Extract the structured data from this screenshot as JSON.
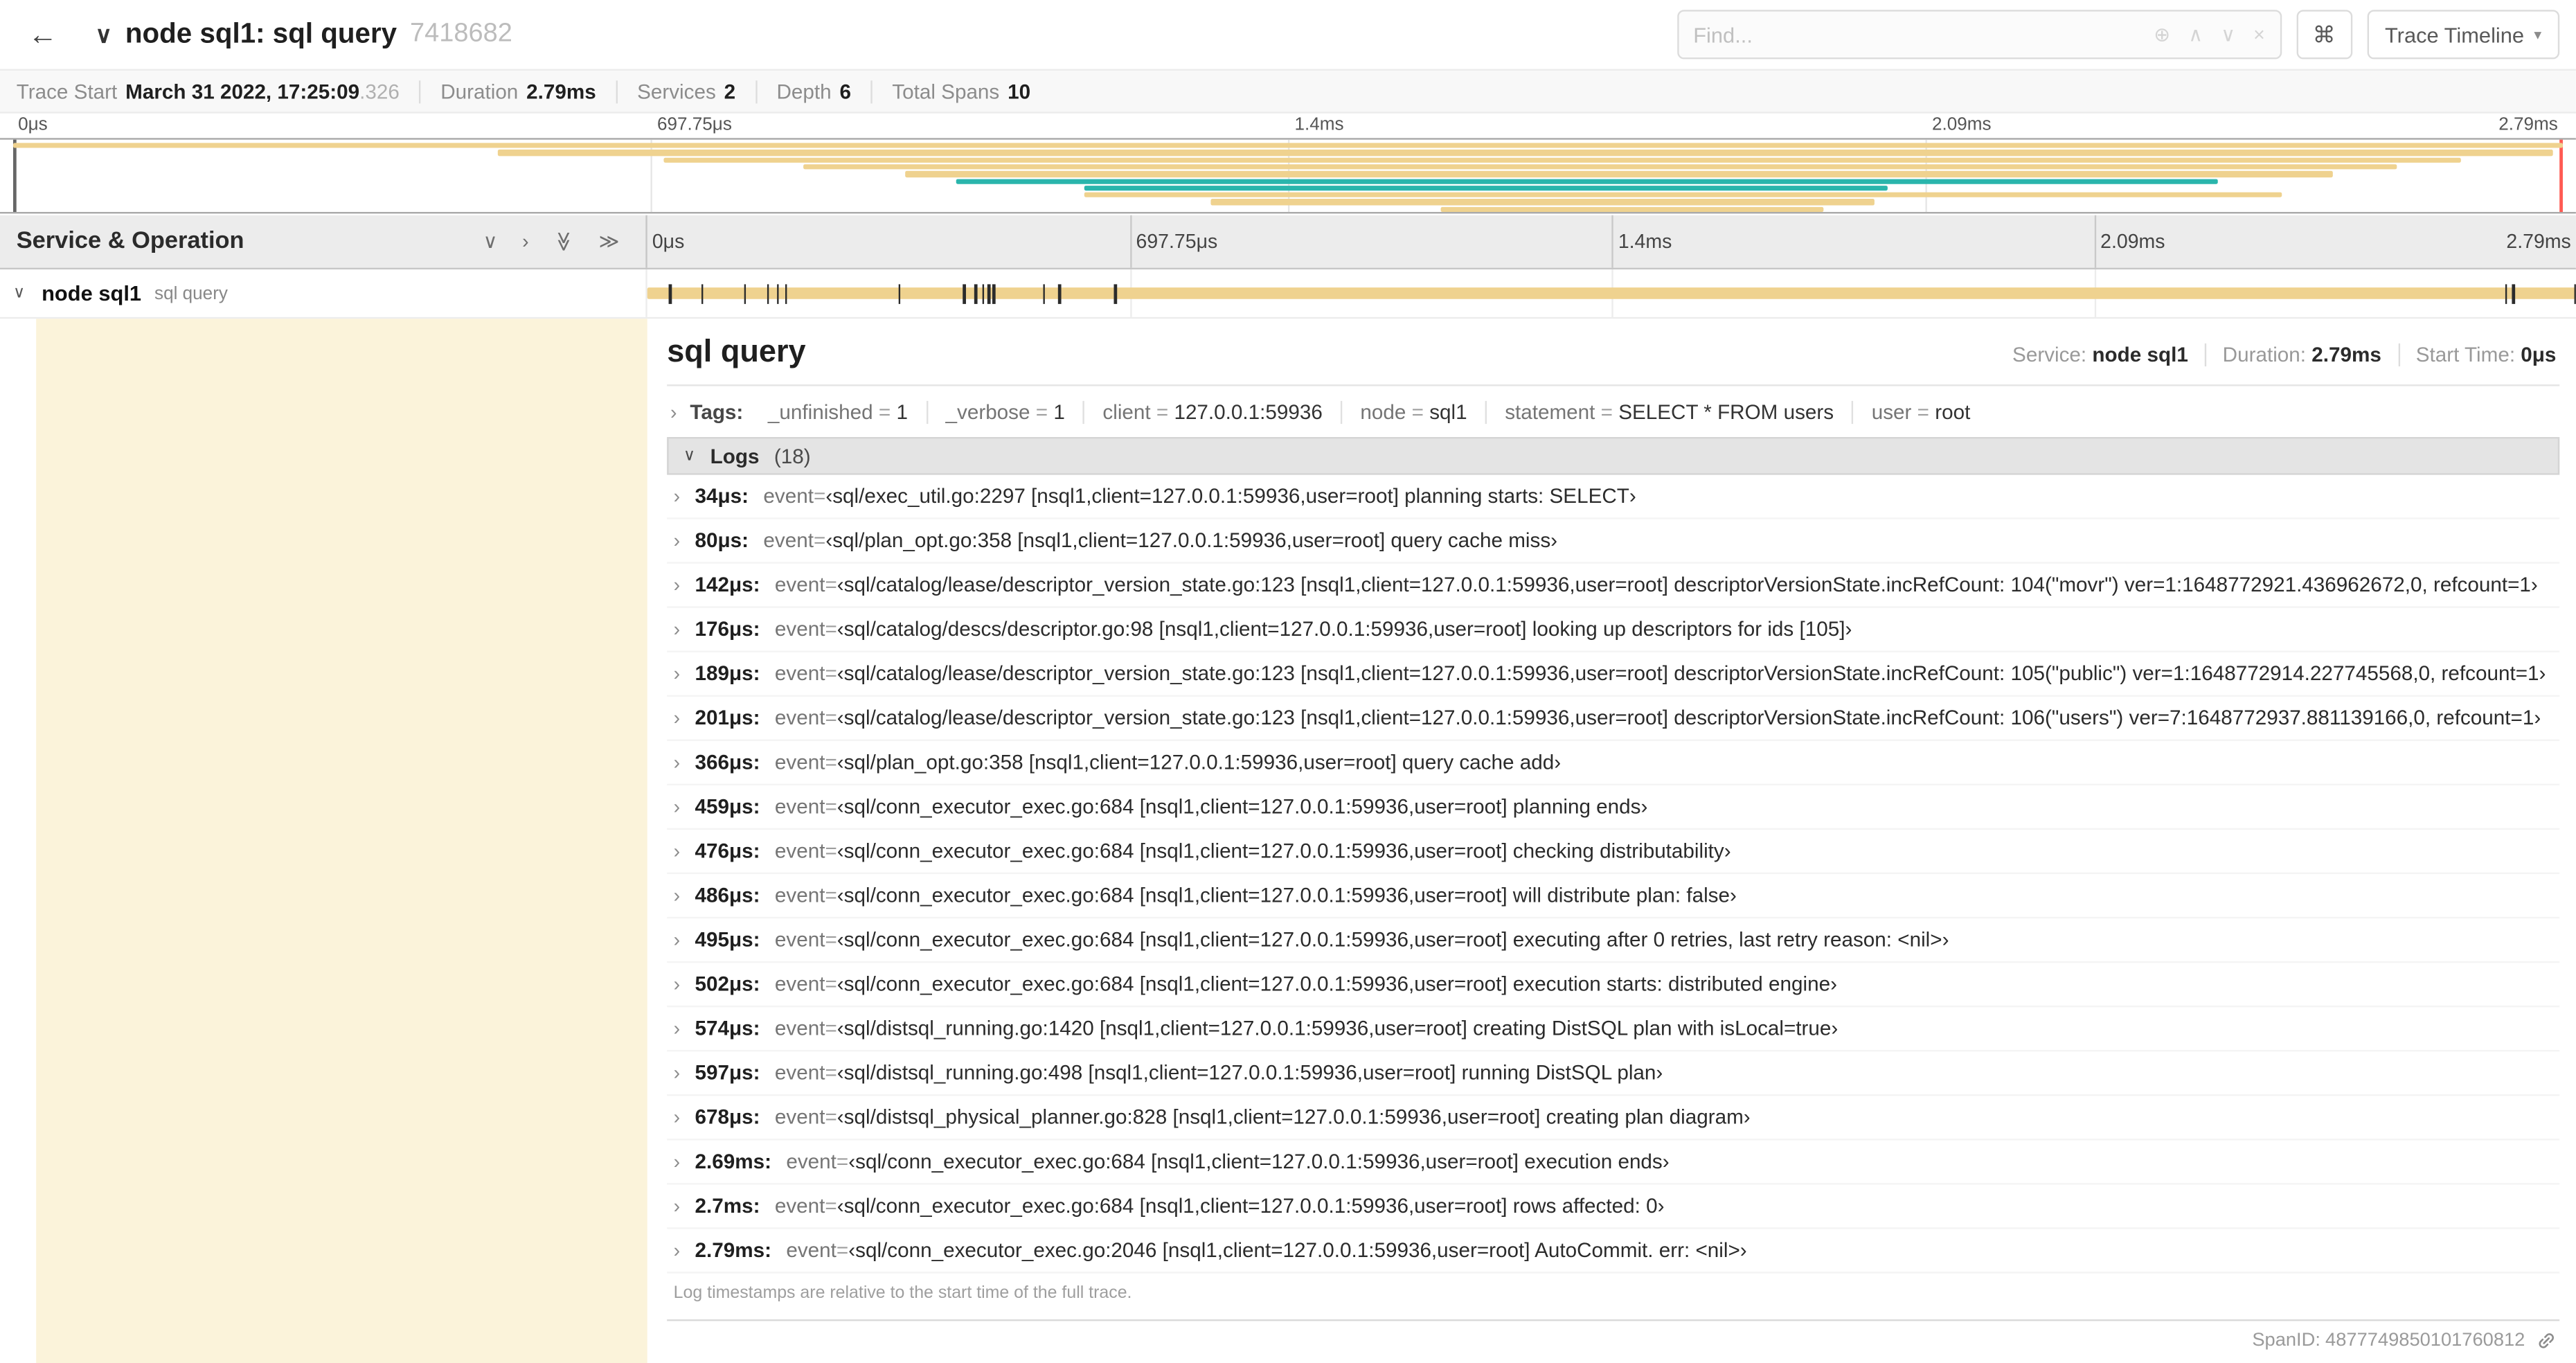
{
  "header": {
    "title": "node sql1: sql query",
    "trace_id": "7418682",
    "find_placeholder": "Find...",
    "trace_timeline_label": "Trace Timeline"
  },
  "icons": {
    "back": "←",
    "collapse_trace": "∨",
    "find_zoom": "⊕",
    "find_prev": "∧",
    "find_next": "∨",
    "find_clear": "×",
    "keyboard_shortcuts": "⌘",
    "dropdown_caret": "▾",
    "collapse_one": "∨",
    "expand_one": "›",
    "collapse_all": "≫",
    "expand_all": "≫",
    "row_chevron": "∨",
    "logs_chevron": "∨"
  },
  "stats": {
    "items": [
      {
        "label": "Trace Start",
        "value": "March 31 2022, 17:25:09",
        "muted": ".326"
      },
      {
        "label": "Duration",
        "value": "2.79ms"
      },
      {
        "label": "Services",
        "value": "2"
      },
      {
        "label": "Depth",
        "value": "6"
      },
      {
        "label": "Total Spans",
        "value": "10"
      }
    ]
  },
  "minimap": {
    "tick_labels": [
      "0μs",
      "697.75μs",
      "1.4ms",
      "2.09ms",
      "2.79ms"
    ],
    "colors": {
      "tan": "#efd28f",
      "teal": "#2ab5ac"
    },
    "spans": [
      {
        "start": 0,
        "end": 100,
        "color": "tan"
      },
      {
        "start": 19,
        "end": 99.6,
        "color": "tan"
      },
      {
        "start": 25.5,
        "end": 96,
        "color": "tan"
      },
      {
        "start": 31,
        "end": 93.5,
        "color": "tan"
      },
      {
        "start": 35,
        "end": 91,
        "color": "tan"
      },
      {
        "start": 37,
        "end": 86.5,
        "color": "teal"
      },
      {
        "start": 42,
        "end": 73.5,
        "color": "teal"
      },
      {
        "start": 42,
        "end": 89,
        "color": "tan"
      },
      {
        "start": 47,
        "end": 73,
        "color": "tan"
      },
      {
        "start": 56,
        "end": 71,
        "color": "tan"
      }
    ]
  },
  "timeline": {
    "section_title": "Service & Operation",
    "tick_labels": [
      "0μs",
      "697.75μs",
      "1.4ms",
      "2.09ms",
      "2.79ms"
    ],
    "trace_duration_us": 2790,
    "row": {
      "service": "node sql1",
      "operation": "sql query"
    }
  },
  "span_detail": {
    "title": "sql query",
    "meta": [
      {
        "label": "Service:",
        "value": "node sql1"
      },
      {
        "label": "Duration:",
        "value": "2.79ms"
      },
      {
        "label": "Start Time:",
        "value": "0μs"
      }
    ],
    "tags_label": "Tags:",
    "tags": [
      {
        "key": "_unfinished",
        "value": "1"
      },
      {
        "key": "_verbose",
        "value": "1"
      },
      {
        "key": "client",
        "value": "127.0.0.1:59936"
      },
      {
        "key": "node",
        "value": "sql1"
      },
      {
        "key": "statement",
        "value": "SELECT * FROM users"
      },
      {
        "key": "user",
        "value": "root"
      }
    ],
    "logs_label": "Logs",
    "logs_count": "(18)",
    "logs": [
      {
        "time": "34μs:",
        "t_us": 34,
        "key": "event",
        "value": "‹sql/exec_util.go:2297 [nsql1,client=127.0.0.1:59936,user=root] planning starts: SELECT›"
      },
      {
        "time": "80μs:",
        "t_us": 80,
        "key": "event",
        "value": "‹sql/plan_opt.go:358 [nsql1,client=127.0.0.1:59936,user=root] query cache miss›"
      },
      {
        "time": "142μs:",
        "t_us": 142,
        "key": "event",
        "value": "‹sql/catalog/lease/descriptor_version_state.go:123 [nsql1,client=127.0.0.1:59936,user=root] descriptorVersionState.incRefCount: 104(\"movr\") ver=1:1648772921.436962672,0, refcount=1›"
      },
      {
        "time": "176μs:",
        "t_us": 176,
        "key": "event",
        "value": "‹sql/catalog/descs/descriptor.go:98 [nsql1,client=127.0.0.1:59936,user=root] looking up descriptors for ids [105]›"
      },
      {
        "time": "189μs:",
        "t_us": 189,
        "key": "event",
        "value": "‹sql/catalog/lease/descriptor_version_state.go:123 [nsql1,client=127.0.0.1:59936,user=root] descriptorVersionState.incRefCount: 105(\"public\") ver=1:1648772914.227745568,0, refcount=1›"
      },
      {
        "time": "201μs:",
        "t_us": 201,
        "key": "event",
        "value": "‹sql/catalog/lease/descriptor_version_state.go:123 [nsql1,client=127.0.0.1:59936,user=root] descriptorVersionState.incRefCount: 106(\"users\") ver=7:1648772937.881139166,0, refcount=1›"
      },
      {
        "time": "366μs:",
        "t_us": 366,
        "key": "event",
        "value": "‹sql/plan_opt.go:358 [nsql1,client=127.0.0.1:59936,user=root] query cache add›"
      },
      {
        "time": "459μs:",
        "t_us": 459,
        "key": "event",
        "value": "‹sql/conn_executor_exec.go:684 [nsql1,client=127.0.0.1:59936,user=root] planning ends›"
      },
      {
        "time": "476μs:",
        "t_us": 476,
        "key": "event",
        "value": "‹sql/conn_executor_exec.go:684 [nsql1,client=127.0.0.1:59936,user=root] checking distributability›"
      },
      {
        "time": "486μs:",
        "t_us": 486,
        "key": "event",
        "value": "‹sql/conn_executor_exec.go:684 [nsql1,client=127.0.0.1:59936,user=root] will distribute plan: false›"
      },
      {
        "time": "495μs:",
        "t_us": 495,
        "key": "event",
        "value": "‹sql/conn_executor_exec.go:684 [nsql1,client=127.0.0.1:59936,user=root] executing after 0 retries, last retry reason: <nil>›"
      },
      {
        "time": "502μs:",
        "t_us": 502,
        "key": "event",
        "value": "‹sql/conn_executor_exec.go:684 [nsql1,client=127.0.0.1:59936,user=root] execution starts: distributed engine›"
      },
      {
        "time": "574μs:",
        "t_us": 574,
        "key": "event",
        "value": "‹sql/distsql_running.go:1420 [nsql1,client=127.0.0.1:59936,user=root] creating DistSQL plan with isLocal=true›"
      },
      {
        "time": "597μs:",
        "t_us": 597,
        "key": "event",
        "value": "‹sql/distsql_running.go:498 [nsql1,client=127.0.0.1:59936,user=root] running DistSQL plan›"
      },
      {
        "time": "678μs:",
        "t_us": 678,
        "key": "event",
        "value": "‹sql/distsql_physical_planner.go:828 [nsql1,client=127.0.0.1:59936,user=root] creating plan diagram›"
      },
      {
        "time": "2.69ms:",
        "t_us": 2690,
        "key": "event",
        "value": "‹sql/conn_executor_exec.go:684 [nsql1,client=127.0.0.1:59936,user=root] execution ends›"
      },
      {
        "time": "2.7ms:",
        "t_us": 2700,
        "key": "event",
        "value": "‹sql/conn_executor_exec.go:684 [nsql1,client=127.0.0.1:59936,user=root] rows affected: 0›"
      },
      {
        "time": "2.79ms:",
        "t_us": 2790,
        "key": "event",
        "value": "‹sql/conn_executor_exec.go:2046 [nsql1,client=127.0.0.1:59936,user=root] AutoCommit. err: <nil>›"
      }
    ],
    "logs_note": "Log timestamps are relative to the start time of the full trace.",
    "span_id_label": "SpanID:",
    "span_id": "4877749850101760812"
  }
}
